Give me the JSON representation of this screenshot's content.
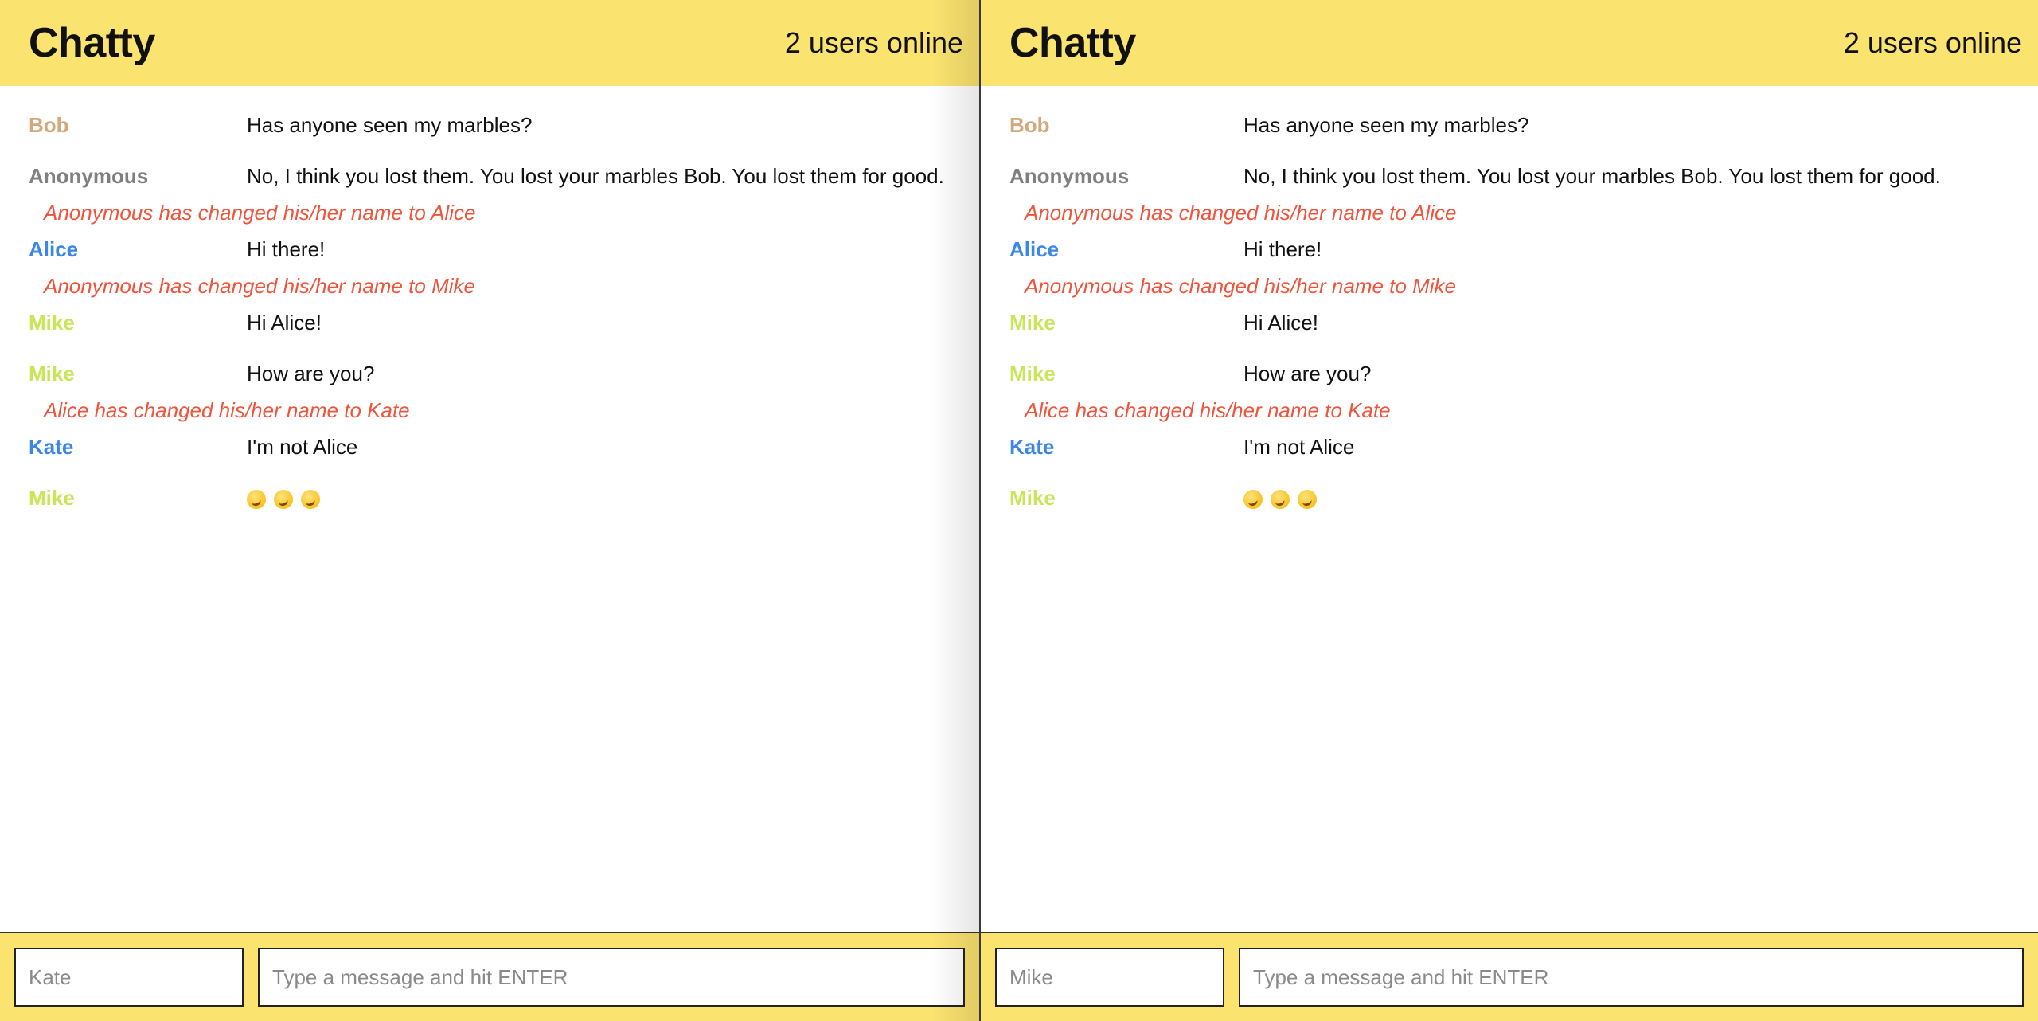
{
  "colors": {
    "header_bg": "#fbe36f",
    "bob": "#d2a97c",
    "anonymous": "#808080",
    "alice": "#3b86e6",
    "mike": "#c9e55a",
    "kate": "#3b86e6",
    "notification": "#f0543c"
  },
  "panels": [
    {
      "navbar": {
        "brand": "Chatty",
        "users_online": "2 users online"
      },
      "messages": [
        {
          "type": "message",
          "user": "Bob",
          "color": "#d2a97c",
          "text": "Has anyone seen my marbles?"
        },
        {
          "type": "message",
          "user": "Anonymous",
          "color": "#808080",
          "text": "No, I think you lost them. You lost your marbles Bob. You lost them for good."
        },
        {
          "type": "notification",
          "text": "Anonymous has changed his/her name to Alice"
        },
        {
          "type": "message",
          "user": "Alice",
          "color": "#3b86e6",
          "text": "Hi there!"
        },
        {
          "type": "notification",
          "text": "Anonymous has changed his/her name to Mike"
        },
        {
          "type": "message",
          "user": "Mike",
          "color": "#c9e55a",
          "text": "Hi Alice!"
        },
        {
          "type": "message",
          "user": "Mike",
          "color": "#c9e55a",
          "text": "How are you?"
        },
        {
          "type": "notification",
          "text": "Alice has changed his/her name to Kate"
        },
        {
          "type": "message",
          "user": "Kate",
          "color": "#3b86e6",
          "text": "I'm not Alice"
        },
        {
          "type": "emoji-message",
          "user": "Mike",
          "color": "#c9e55a",
          "emoji_icon": "rolling-on-floor-laughing-icon",
          "emoji_count": 3
        }
      ],
      "footer": {
        "name_placeholder": "Kate",
        "message_placeholder": "Type a message and hit ENTER"
      }
    },
    {
      "navbar": {
        "brand": "Chatty",
        "users_online": "2 users online"
      },
      "messages": [
        {
          "type": "message",
          "user": "Bob",
          "color": "#d2a97c",
          "text": "Has anyone seen my marbles?"
        },
        {
          "type": "message",
          "user": "Anonymous",
          "color": "#808080",
          "text": "No, I think you lost them. You lost your marbles Bob. You lost them for good."
        },
        {
          "type": "notification",
          "text": "Anonymous has changed his/her name to Alice"
        },
        {
          "type": "message",
          "user": "Alice",
          "color": "#3b86e6",
          "text": "Hi there!"
        },
        {
          "type": "notification",
          "text": "Anonymous has changed his/her name to Mike"
        },
        {
          "type": "message",
          "user": "Mike",
          "color": "#c9e55a",
          "text": "Hi Alice!"
        },
        {
          "type": "message",
          "user": "Mike",
          "color": "#c9e55a",
          "text": "How are you?"
        },
        {
          "type": "notification",
          "text": "Alice has changed his/her name to Kate"
        },
        {
          "type": "message",
          "user": "Kate",
          "color": "#3b86e6",
          "text": "I'm not Alice"
        },
        {
          "type": "emoji-message",
          "user": "Mike",
          "color": "#c9e55a",
          "emoji_icon": "rolling-on-floor-laughing-icon",
          "emoji_count": 3
        }
      ],
      "footer": {
        "name_placeholder": "Mike",
        "message_placeholder": "Type a message and hit ENTER"
      }
    }
  ]
}
